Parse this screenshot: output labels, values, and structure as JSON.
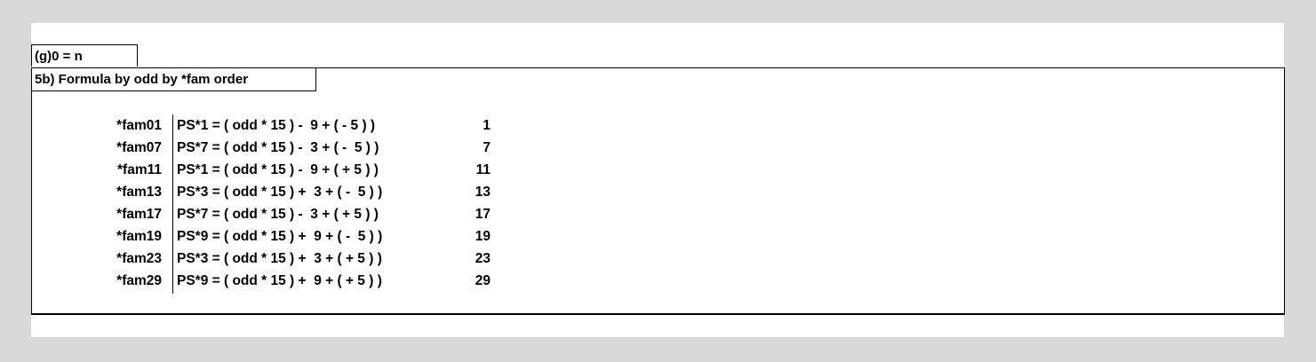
{
  "header": {
    "g_label": "(g)0 = n"
  },
  "section": {
    "title": "5b) Formula by odd by *fam order"
  },
  "rows": [
    {
      "fam": "*fam01",
      "formula": "PS*1 = ( odd * 15 ) -  9 + ( - 5 ) )",
      "num": "1"
    },
    {
      "fam": "*fam07",
      "formula": "PS*7 = ( odd * 15 ) -  3 + ( -  5 ) )",
      "num": "7"
    },
    {
      "fam": "*fam11",
      "formula": "PS*1 = ( odd * 15 ) -  9 + ( + 5 ) )",
      "num": "11"
    },
    {
      "fam": "*fam13",
      "formula": "PS*3 = ( odd * 15 ) +  3 + ( -  5 ) )",
      "num": "13"
    },
    {
      "fam": "*fam17",
      "formula": "PS*7 = ( odd * 15 ) -  3 + ( + 5 ) )",
      "num": "17"
    },
    {
      "fam": "*fam19",
      "formula": "PS*9 = ( odd * 15 ) +  9 + ( -  5 ) )",
      "num": "19"
    },
    {
      "fam": "*fam23",
      "formula": "PS*3 = ( odd * 15 ) +  3 + ( + 5 ) )",
      "num": "23"
    },
    {
      "fam": "*fam29",
      "formula": "PS*9 = ( odd * 15 ) +  9 + ( + 5 ) )",
      "num": "29"
    }
  ]
}
